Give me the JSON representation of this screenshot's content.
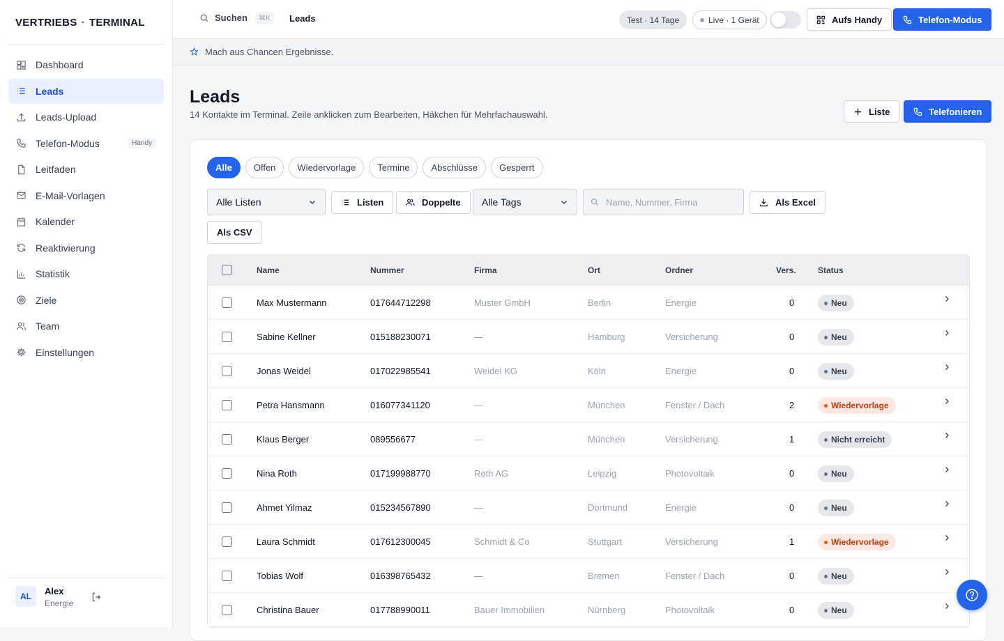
{
  "brand": {
    "left": "VERTRIEBS",
    "sep": "·",
    "right": "TERMINAL"
  },
  "nav": [
    {
      "label": "Dashboard",
      "icon": "grid-icon",
      "active": false
    },
    {
      "label": "Leads",
      "icon": "list-icon",
      "active": true
    },
    {
      "label": "Leads-Upload",
      "icon": "upload-icon",
      "active": false
    },
    {
      "label": "Telefon-Modus",
      "icon": "phone-icon",
      "active": false,
      "badge": "Handy"
    },
    {
      "label": "Leitfaden",
      "icon": "document-icon",
      "active": false
    },
    {
      "label": "E-Mail-Vorlagen",
      "icon": "mail-icon",
      "active": false
    },
    {
      "label": "Kalender",
      "icon": "calendar-icon",
      "active": false
    },
    {
      "label": "Reaktivierung",
      "icon": "refresh-icon",
      "active": false
    },
    {
      "label": "Statistik",
      "icon": "bar-chart-icon",
      "active": false
    },
    {
      "label": "Ziele",
      "icon": "target-icon",
      "active": false
    },
    {
      "label": "Team",
      "icon": "users-icon",
      "active": false
    },
    {
      "label": "Einstellungen",
      "icon": "gear-icon",
      "active": false
    }
  ],
  "user": {
    "initials": "AL",
    "name": "Alex",
    "role": "Energie"
  },
  "topbar": {
    "search_label": "Suchen",
    "shortcut": "⌘K",
    "title": "Leads",
    "trial": "Test · 14 Tage",
    "live": "Live · 1 Gerät",
    "handy_button": "Aufs Handy",
    "phone_mode_button": "Telefon-Modus"
  },
  "banner": "Mach aus Chancen Ergebnisse.",
  "page": {
    "title": "Leads",
    "subtitle": "14 Kontakte im Terminal. Zeile anklicken zum Bearbeiten, Häkchen für Mehrfachauswahl.",
    "add_list": "Liste",
    "call": "Telefonieren"
  },
  "filters": [
    "Alle",
    "Offen",
    "Wiedervorlage",
    "Termine",
    "Abschlüsse",
    "Gesperrt"
  ],
  "controls": {
    "lists_select": "Alle Listen",
    "lists_button": "Listen",
    "duplicates_button": "Doppelte",
    "tags_select": "Alle Tags",
    "search_placeholder": "Name, Nummer, Firma",
    "excel_button": "Als Excel",
    "csv_button": "Als CSV"
  },
  "colors": {
    "accent": "#2563eb",
    "status_new": "#e5e7eb",
    "status_followup": "#fde8e4",
    "followup_text": "#c2410c"
  },
  "table": {
    "headers": {
      "name": "Name",
      "number": "Nummer",
      "company": "Firma",
      "city": "Ort",
      "folder": "Ordner",
      "attempts": "Vers.",
      "status": "Status"
    },
    "rows": [
      {
        "name": "Max Mustermann",
        "number": "017644712298",
        "company": "Muster GmbH",
        "city": "Berlin",
        "folder": "Energie",
        "attempts": "0",
        "status": "Neu",
        "kind": "new"
      },
      {
        "name": "Sabine Kellner",
        "number": "015188230071",
        "company": "—",
        "city": "Hamburg",
        "folder": "Versicherung",
        "attempts": "0",
        "status": "Neu",
        "kind": "new"
      },
      {
        "name": "Jonas Weidel",
        "number": "017022985541",
        "company": "Weidel KG",
        "city": "Köln",
        "folder": "Energie",
        "attempts": "0",
        "status": "Neu",
        "kind": "new"
      },
      {
        "name": "Petra Hansmann",
        "number": "016077341120",
        "company": "—",
        "city": "München",
        "folder": "Fenster / Dach",
        "attempts": "2",
        "status": "Wiedervorlage",
        "kind": "followup"
      },
      {
        "name": "Klaus Berger",
        "number": "089556677",
        "company": "—",
        "city": "München",
        "folder": "Versicherung",
        "attempts": "1",
        "status": "Nicht erreicht",
        "kind": "missed"
      },
      {
        "name": "Nina Roth",
        "number": "017199988770",
        "company": "Roth AG",
        "city": "Leipzig",
        "folder": "Photovoltaik",
        "attempts": "0",
        "status": "Neu",
        "kind": "new"
      },
      {
        "name": "Ahmet Yilmaz",
        "number": "015234567890",
        "company": "—",
        "city": "Dortmund",
        "folder": "Energie",
        "attempts": "0",
        "status": "Neu",
        "kind": "new"
      },
      {
        "name": "Laura Schmidt",
        "number": "017612300045",
        "company": "Schmidt & Co",
        "city": "Stuttgart",
        "folder": "Versicherung",
        "attempts": "1",
        "status": "Wiedervorlage",
        "kind": "followup"
      },
      {
        "name": "Tobias Wolf",
        "number": "016398765432",
        "company": "—",
        "city": "Bremen",
        "folder": "Fenster / Dach",
        "attempts": "0",
        "status": "Neu",
        "kind": "new"
      },
      {
        "name": "Christina Bauer",
        "number": "017788990011",
        "company": "Bauer Immobilien",
        "city": "Nürnberg",
        "folder": "Photovoltaik",
        "attempts": "0",
        "status": "Neu",
        "kind": "new"
      }
    ]
  }
}
